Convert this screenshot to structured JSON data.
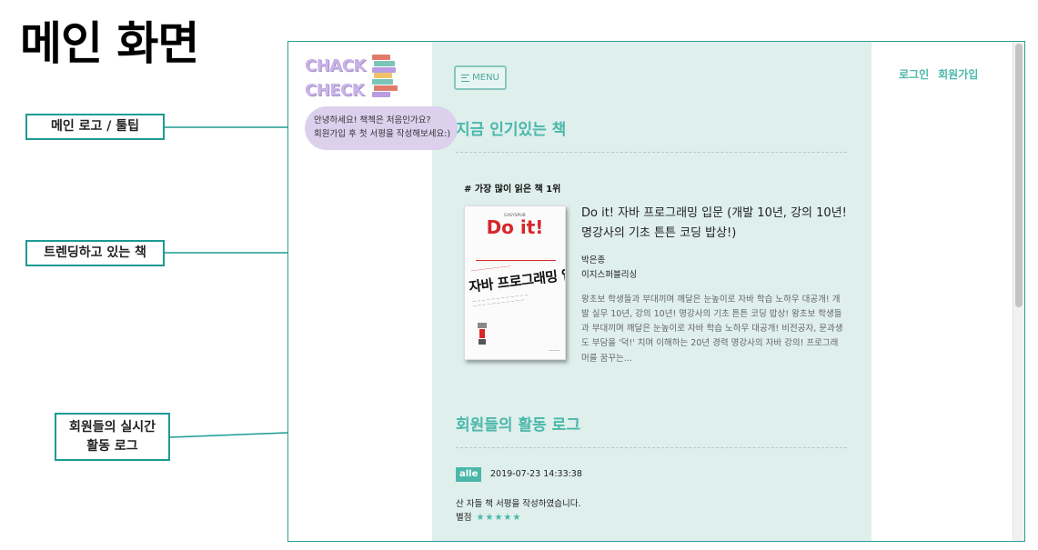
{
  "slide": {
    "title": "메인 화면"
  },
  "callouts": [
    {
      "label": "메인 로고 / 툴팁"
    },
    {
      "label": "트렌딩하고 있는 책"
    },
    {
      "label_line1": "회원들의 실시간",
      "label_line2": "활동 로그"
    }
  ],
  "logo": {
    "line1": "CHACK",
    "line2": "CHECK",
    "icon": "book-stack-icon",
    "book_colors": [
      "#e07b6a",
      "#7bc4b8",
      "#b99de0",
      "#f0c36a",
      "#7bc4b8",
      "#e07b6a",
      "#b99de0"
    ]
  },
  "tooltip": {
    "line1": "안녕하세요! 책첵은 처음인가요?",
    "line2": "회원가입 후 첫 서평을 작성해보세요:)"
  },
  "header": {
    "menu_label": "MENU",
    "menu_icon": "hamburger-icon",
    "login": "로그인",
    "signup": "회원가입"
  },
  "trending": {
    "section_title": "지금 인기있는 책",
    "rank_label": "# 가장 많이 읽은 책 1위",
    "book": {
      "title": "Do it! 자바 프로그래밍 입문 (개발 10년, 강의 10년! 명강사의 기초 튼튼 코딩 밥상!)",
      "author": "박은종",
      "publisher": "이지스퍼블리싱",
      "description": "왕초보 학생들과 부대끼며 깨달은 눈높이로 자바 학습 노하우 대공개! 개발 실무 10년, 강의 10년! 명강사의 기초 튼튼 코딩 밥상! 왕초보 학생들과 부대끼며 깨달은 눈높이로 자바 학습 노하우 대공개! 비전공자, 문과생도 부담을 '덕!' 치며 이해하는 20년 경력 명강사의 자바 강의! 프로그래머를 꿈꾸는...",
      "cover": {
        "series": "Do it!",
        "title": "자바 프로그래밍 입문"
      }
    }
  },
  "activity": {
    "section_title": "회원들의 활동 로그",
    "entries": [
      {
        "user": "alle",
        "timestamp": "2019-07-23 14:33:38",
        "action": "산 자들 책 서평을 작성하였습니다.",
        "rating_label": "별점",
        "stars": "★★★★★"
      }
    ]
  },
  "colors": {
    "accent": "#4ab7aa",
    "main_background": "#deefec",
    "tooltip_background": "#dcd0ed",
    "callout_border": "#1d9a93"
  }
}
